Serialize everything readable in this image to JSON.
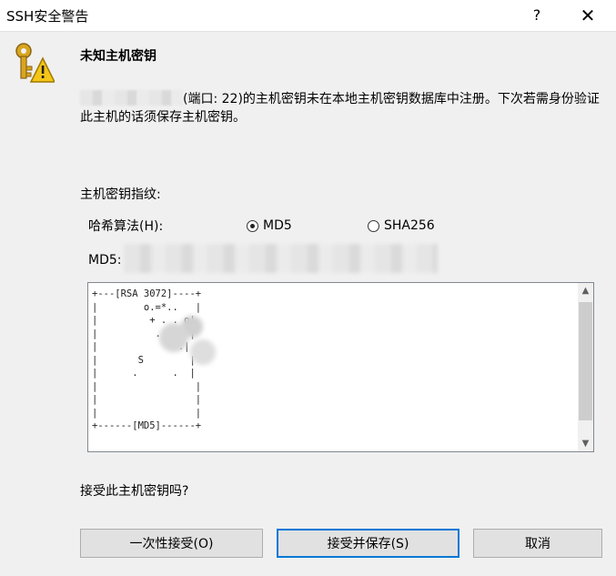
{
  "window": {
    "title": "SSH安全警告",
    "help_glyph": "?",
    "close_glyph": "✕",
    "icon": "key-warning-icon"
  },
  "heading": "未知主机密钥",
  "message": "(端口: 22)的主机密钥未在本地主机密钥数据库中注册。下次若需身份验证此主机的话须保存主机密钥。",
  "fingerprint": {
    "label": "主机密钥指纹:",
    "hash_label": "哈希算法(H):",
    "options": [
      {
        "label": "MD5",
        "selected": true
      },
      {
        "label": "SHA256",
        "selected": false
      }
    ],
    "md5_label": "MD5:"
  },
  "randomart": "+---[RSA 3072]----+\n|        o.=*..   |\n|         + . . o|\n|          .     |\n|              .|\n|       S        |\n|      .      .  |\n|                 |\n|                 |\n|                 |\n+------[MD5]------+",
  "question": "接受此主机密钥吗?",
  "buttons": {
    "once": "一次性接受(O)",
    "accept_save": "接受并保存(S)",
    "cancel": "取消"
  },
  "colors": {
    "accent": "#0078d7",
    "dialog_bg": "#f0f0f0"
  }
}
